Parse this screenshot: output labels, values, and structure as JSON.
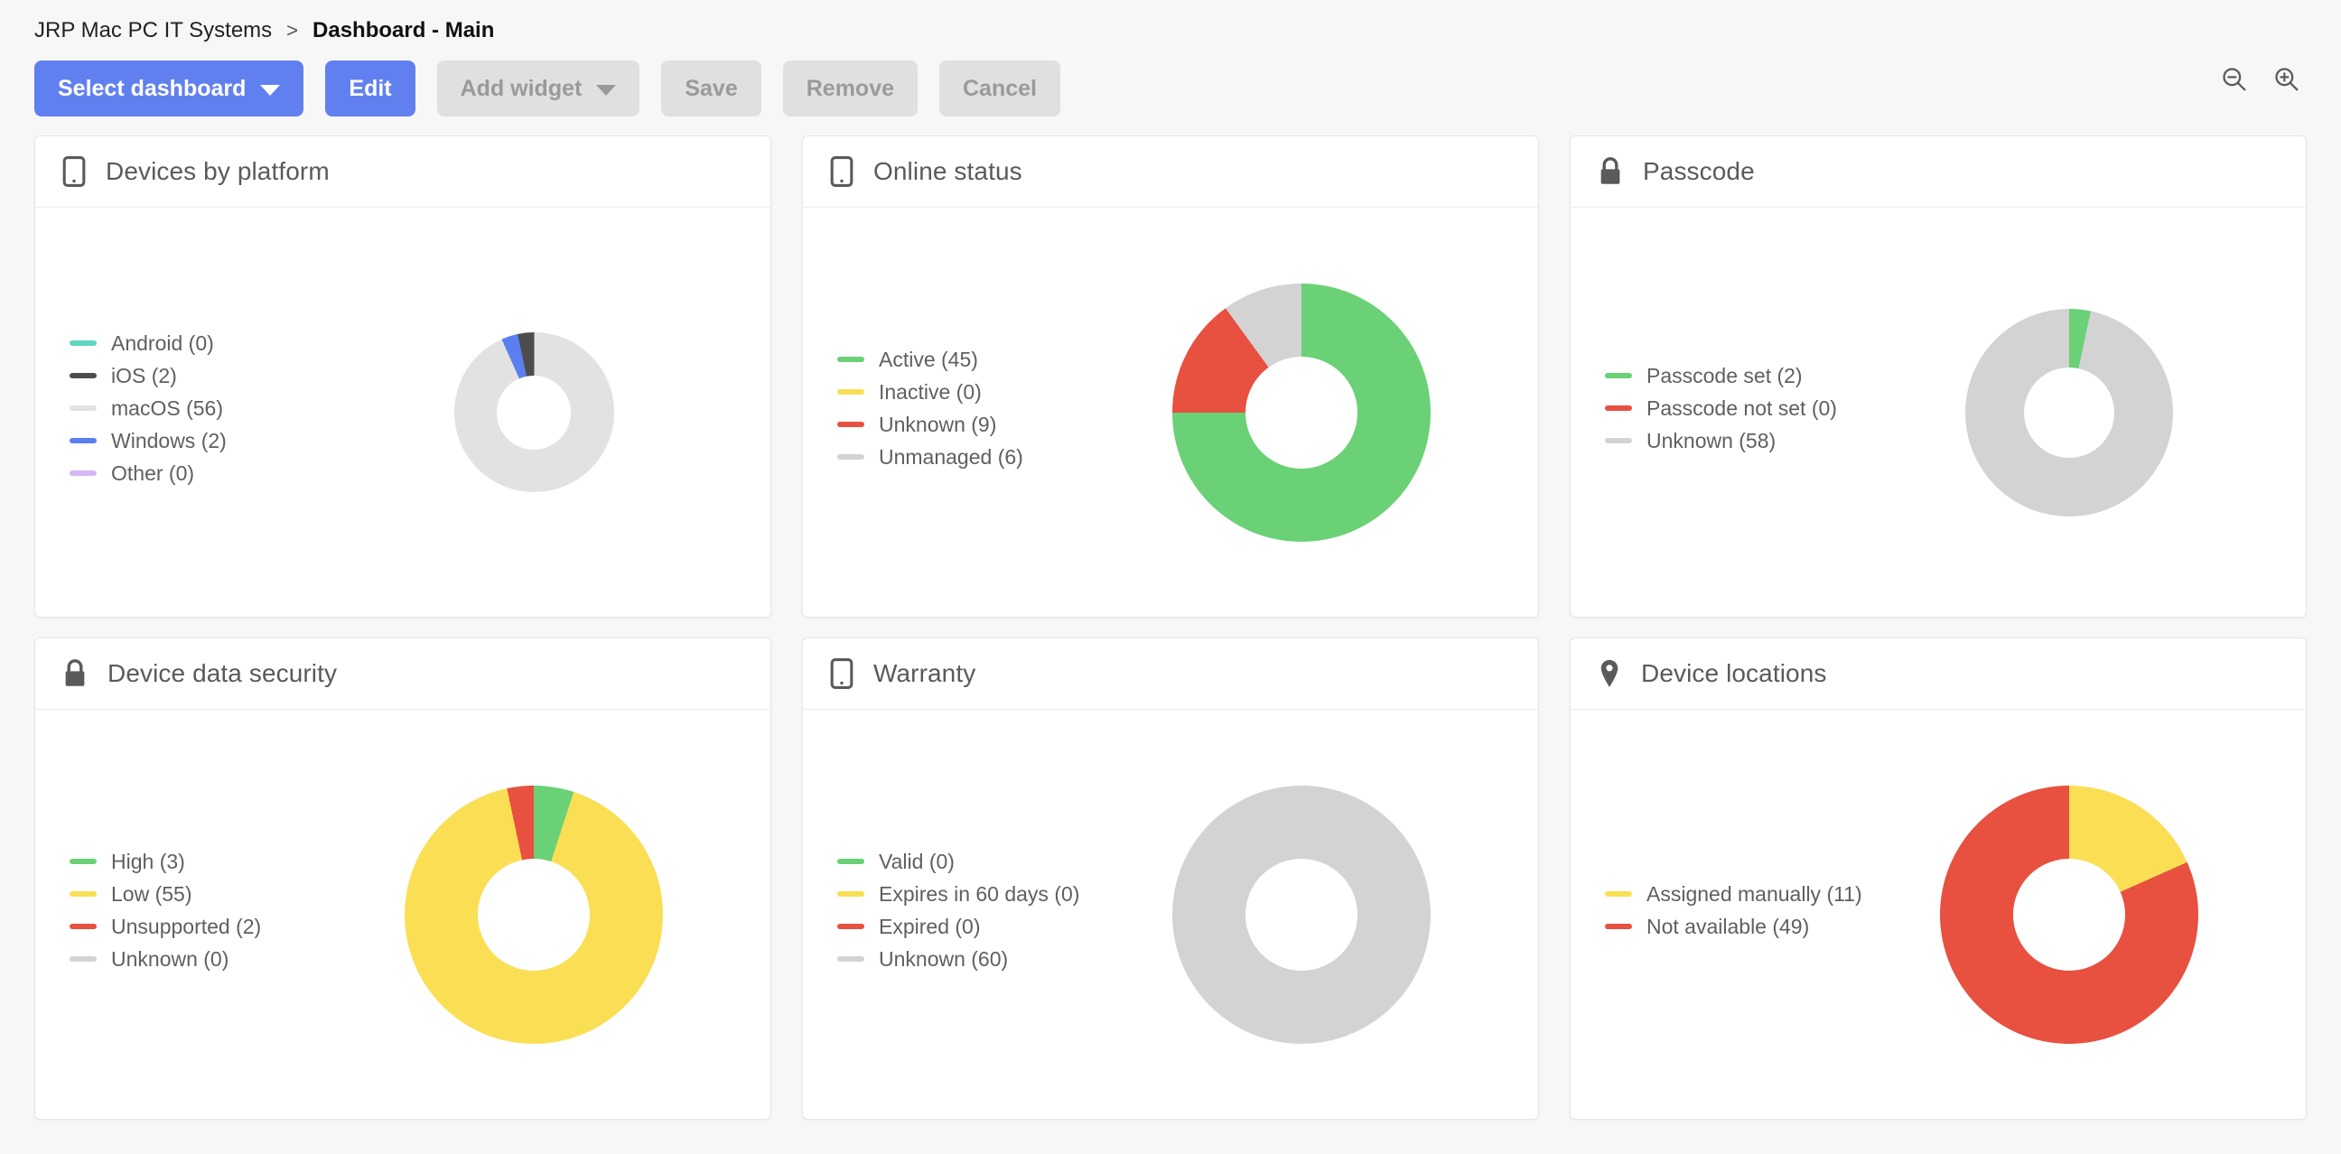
{
  "breadcrumb": {
    "root": "JRP Mac PC IT Systems",
    "separator": ">",
    "current": "Dashboard - Main"
  },
  "toolbar": {
    "select_dashboard_label": "Select dashboard",
    "edit_label": "Edit",
    "add_widget_label": "Add widget",
    "save_label": "Save",
    "remove_label": "Remove",
    "cancel_label": "Cancel",
    "zoom_out_icon": "zoom-out-icon",
    "zoom_in_icon": "zoom-in-icon",
    "accent_color": "#6180f0",
    "disabled_color": "#e0e0e0"
  },
  "palette": {
    "green": "#6ad176",
    "yellow": "#fadf55",
    "red": "#e8503f",
    "gray": "#d3d3d3",
    "light_gray": "#e2e2e2",
    "dark_gray": "#4d4d4d",
    "blue": "#5b7fee",
    "teal": "#5fd6bd",
    "purple": "#d6b6f5"
  },
  "widgets": [
    {
      "title": "Devices by platform",
      "icon": "mobile-device-icon",
      "legend": [
        {
          "label": "Android (0)",
          "color": "#5fd6bd"
        },
        {
          "label": "iOS (2)",
          "color": "#4d4d4d"
        },
        {
          "label": "macOS (56)",
          "color": "#e2e2e2"
        },
        {
          "label": "Windows (2)",
          "color": "#5b7fee"
        },
        {
          "label": "Other (0)",
          "color": "#d6b6f5"
        }
      ]
    },
    {
      "title": "Online status",
      "icon": "mobile-device-icon",
      "legend": [
        {
          "label": "Active (45)",
          "color": "#6ad176"
        },
        {
          "label": "Inactive (0)",
          "color": "#fadf55"
        },
        {
          "label": "Unknown (9)",
          "color": "#e8503f"
        },
        {
          "label": "Unmanaged (6)",
          "color": "#d3d3d3"
        }
      ]
    },
    {
      "title": "Passcode",
      "icon": "lock-icon",
      "legend": [
        {
          "label": "Passcode set (2)",
          "color": "#6ad176"
        },
        {
          "label": "Passcode not set (0)",
          "color": "#e8503f"
        },
        {
          "label": "Unknown (58)",
          "color": "#d3d3d3"
        }
      ]
    },
    {
      "title": "Device data security",
      "icon": "lock-icon",
      "legend": [
        {
          "label": "High (3)",
          "color": "#6ad176"
        },
        {
          "label": "Low (55)",
          "color": "#fadf55"
        },
        {
          "label": "Unsupported (2)",
          "color": "#e8503f"
        },
        {
          "label": "Unknown (0)",
          "color": "#d3d3d3"
        }
      ]
    },
    {
      "title": "Warranty",
      "icon": "mobile-device-icon",
      "legend": [
        {
          "label": "Valid (0)",
          "color": "#6ad176"
        },
        {
          "label": "Expires in 60 days (0)",
          "color": "#fadf55"
        },
        {
          "label": "Expired (0)",
          "color": "#e8503f"
        },
        {
          "label": "Unknown (60)",
          "color": "#d3d3d3"
        }
      ]
    },
    {
      "title": "Device locations",
      "icon": "map-pin-icon",
      "legend": [
        {
          "label": "Assigned manually (11)",
          "color": "#fadf55"
        },
        {
          "label": "Not available (49)",
          "color": "#e8503f"
        }
      ]
    }
  ],
  "chart_data": [
    {
      "type": "pie",
      "title": "Devices by platform",
      "categories": [
        "Android",
        "iOS",
        "macOS",
        "Windows",
        "Other"
      ],
      "values": [
        0,
        2,
        56,
        2,
        0
      ],
      "colors": [
        "#5fd6bd",
        "#4d4d4d",
        "#e2e2e2",
        "#5b7fee",
        "#d6b6f5"
      ],
      "total": 60,
      "legend_position": "left",
      "donut": true,
      "start_angle": 0,
      "render_order": [
        "macOS",
        "Windows",
        "iOS"
      ]
    },
    {
      "type": "pie",
      "title": "Online status",
      "categories": [
        "Active",
        "Inactive",
        "Unknown",
        "Unmanaged"
      ],
      "values": [
        45,
        0,
        9,
        6
      ],
      "colors": [
        "#6ad176",
        "#fadf55",
        "#e8503f",
        "#d3d3d3"
      ],
      "total": 60,
      "legend_position": "left",
      "donut": true,
      "start_angle": 0
    },
    {
      "type": "pie",
      "title": "Passcode",
      "categories": [
        "Passcode set",
        "Passcode not set",
        "Unknown"
      ],
      "values": [
        2,
        0,
        58
      ],
      "colors": [
        "#6ad176",
        "#e8503f",
        "#d3d3d3"
      ],
      "total": 60,
      "legend_position": "left",
      "donut": true,
      "start_angle": 0
    },
    {
      "type": "pie",
      "title": "Device data security",
      "categories": [
        "High",
        "Low",
        "Unsupported",
        "Unknown"
      ],
      "values": [
        3,
        55,
        2,
        0
      ],
      "colors": [
        "#6ad176",
        "#fadf55",
        "#e8503f",
        "#d3d3d3"
      ],
      "total": 60,
      "legend_position": "left",
      "donut": true,
      "start_angle": 0
    },
    {
      "type": "pie",
      "title": "Warranty",
      "categories": [
        "Valid",
        "Expires in 60 days",
        "Expired",
        "Unknown"
      ],
      "values": [
        0,
        0,
        0,
        60
      ],
      "colors": [
        "#6ad176",
        "#fadf55",
        "#e8503f",
        "#d3d3d3"
      ],
      "total": 60,
      "legend_position": "left",
      "donut": true,
      "start_angle": 0
    },
    {
      "type": "pie",
      "title": "Device locations",
      "categories": [
        "Assigned manually",
        "Not available"
      ],
      "values": [
        11,
        49
      ],
      "colors": [
        "#fadf55",
        "#e8503f"
      ],
      "total": 60,
      "legend_position": "left",
      "donut": true,
      "start_angle": 0
    }
  ]
}
